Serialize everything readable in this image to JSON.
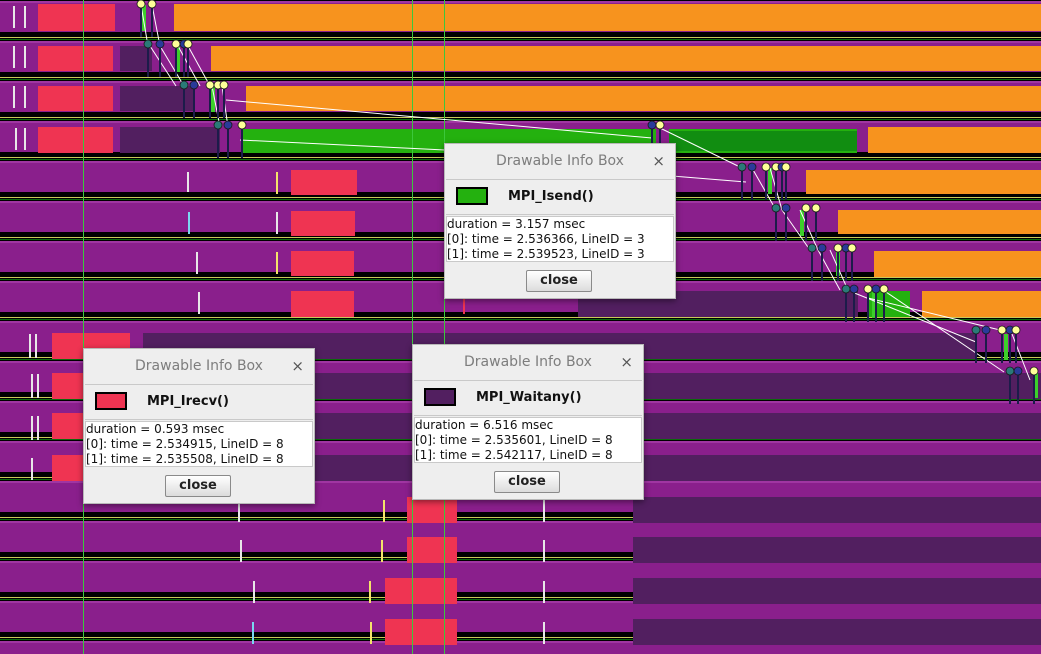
{
  "colors": {
    "mpi_isend": "#24b10f",
    "mpi_irecv": "#ef3452",
    "mpi_waitany": "#521f60",
    "other_state": "#f7931e",
    "rank_background": "#8a1f8c",
    "arrow": "#ffffff",
    "marker_yellow": "#ffff99",
    "marker_blue": "#2a3a9a",
    "marker_teal": "#2a7a78",
    "guide_line": "#3cc83c"
  },
  "info_boxes": [
    {
      "id": "isend",
      "title": "Drawable Info Box",
      "close_glyph": "×",
      "name": "MPI_Isend()",
      "swatch_color": "#24b10f",
      "lines": [
        "duration = 3.157 msec",
        "[0]: time = 2.536366, LineID = 3",
        "[1]: time = 2.539523, LineID = 3"
      ],
      "close_label": "close"
    },
    {
      "id": "irecv",
      "title": "Drawable Info Box",
      "close_glyph": "×",
      "name": "MPI_Irecv()",
      "swatch_color": "#ef3452",
      "lines": [
        "duration = 0.593 msec",
        "[0]: time = 2.534915, LineID = 8",
        "[1]: time = 2.535508, LineID = 8"
      ],
      "close_label": "close"
    },
    {
      "id": "waitany",
      "title": "Drawable Info Box",
      "close_glyph": "×",
      "name": "MPI_Waitany()",
      "swatch_color": "#521f60",
      "lines": [
        "duration = 6.516 msec",
        "[0]: time = 2.535601, LineID = 8",
        "[1]: time = 2.542117, LineID = 8"
      ],
      "close_label": "close"
    }
  ]
}
